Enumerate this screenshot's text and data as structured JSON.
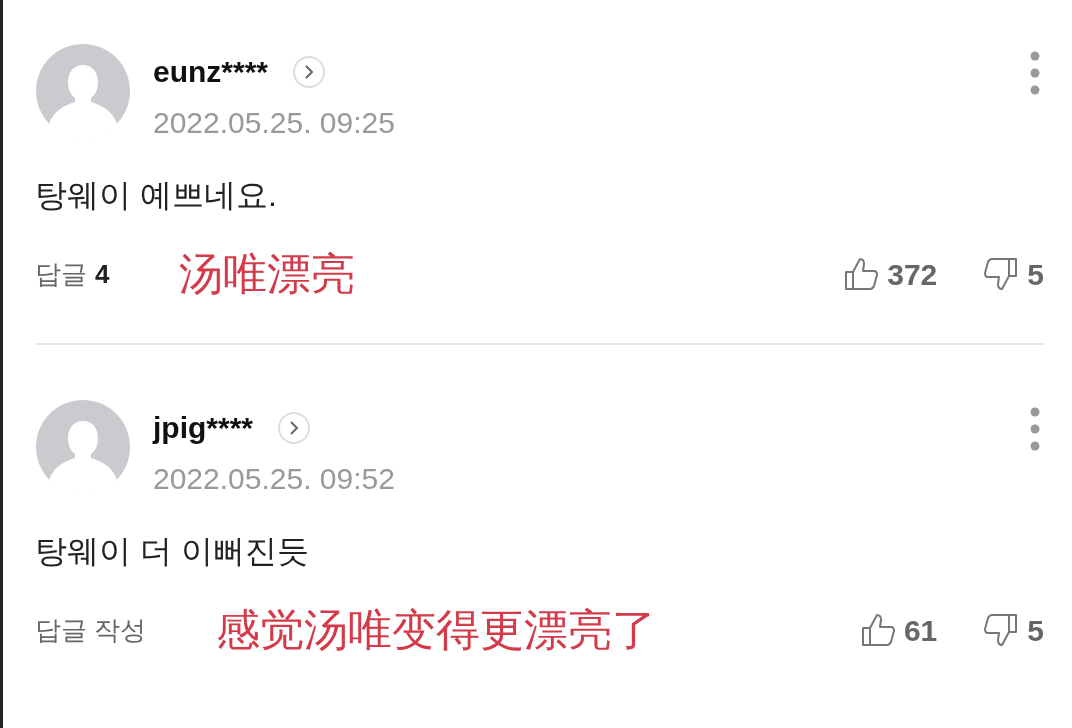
{
  "comments": [
    {
      "username": "eunz****",
      "date": "2022.05.25. 09:25",
      "text": "탕웨이 예쁘네요.",
      "reply_label": "답글",
      "reply_count": "4",
      "translation": "汤唯漂亮",
      "likes": "372",
      "dislikes": "5"
    },
    {
      "username": "jpig****",
      "date": "2022.05.25. 09:52",
      "text": "탕웨이 더 이뻐진듯",
      "reply_label": "답글 작성",
      "translation": "感觉汤唯变得更漂亮了",
      "likes": "61",
      "dislikes": "5"
    }
  ]
}
